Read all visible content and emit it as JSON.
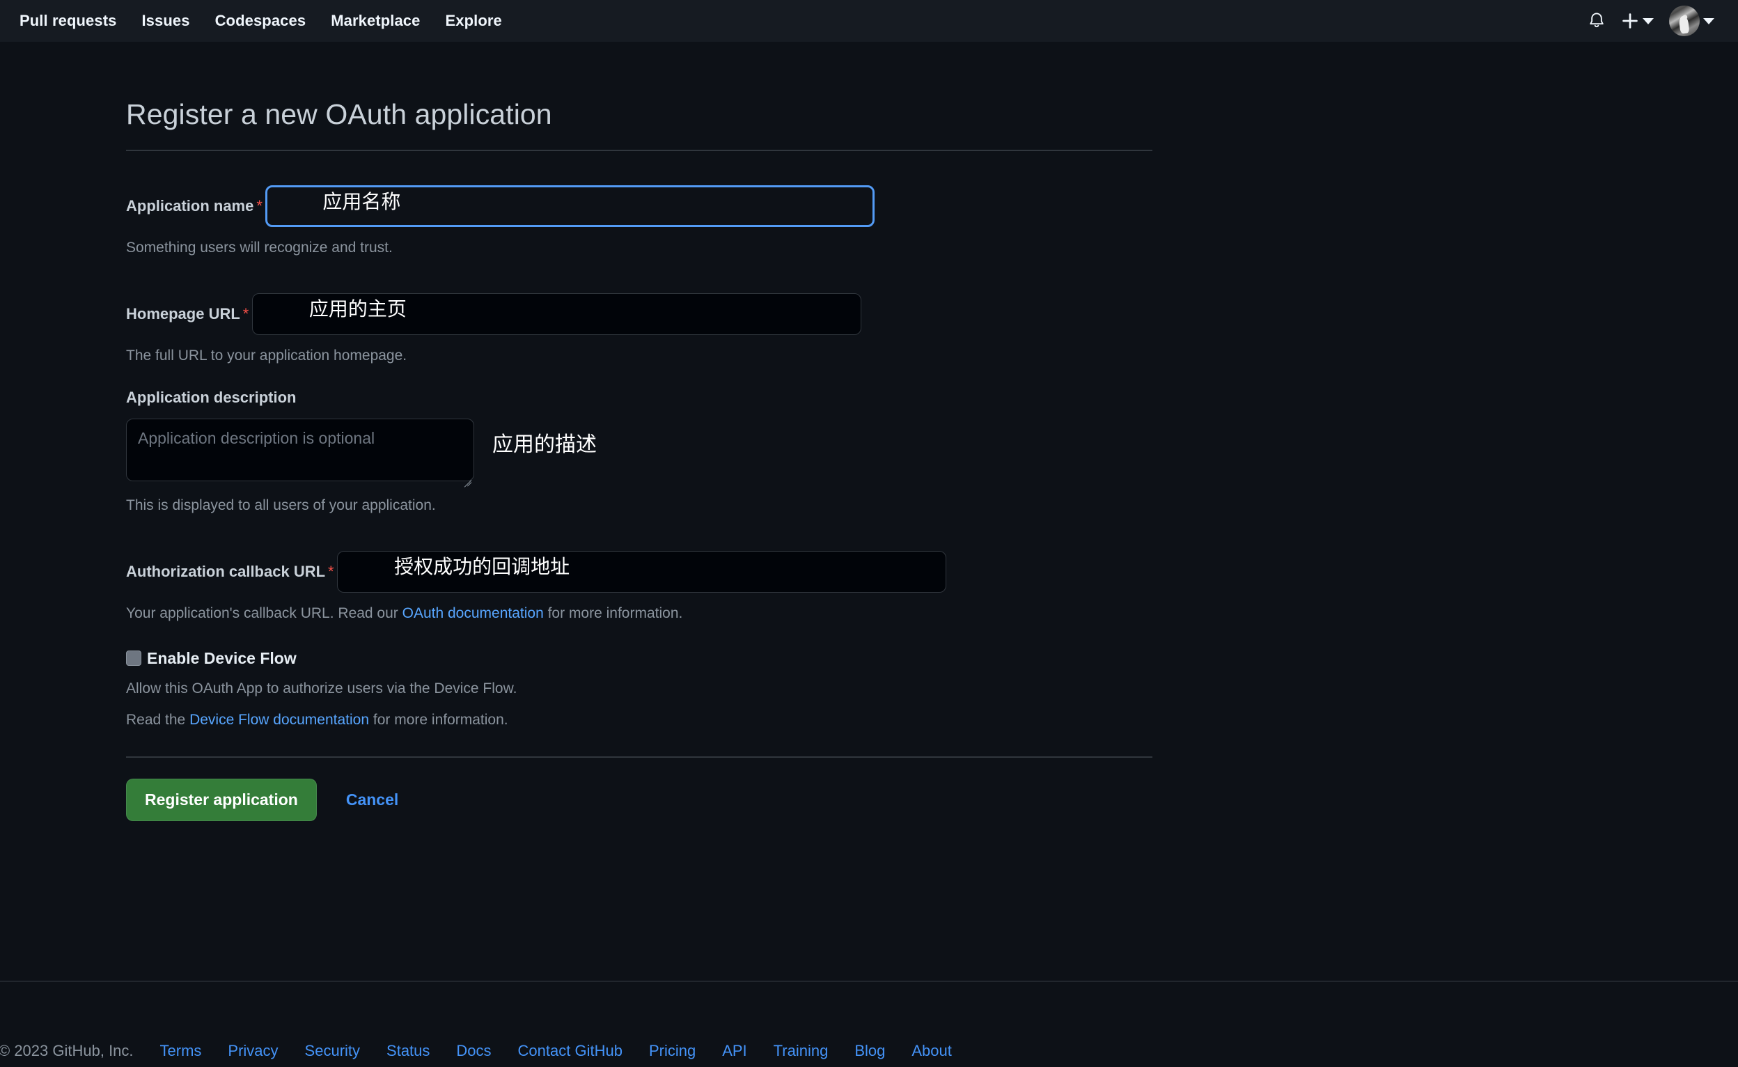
{
  "header": {
    "nav": [
      {
        "label": "Pull requests",
        "name": "nav-pull-requests"
      },
      {
        "label": "Issues",
        "name": "nav-issues"
      },
      {
        "label": "Codespaces",
        "name": "nav-codespaces"
      },
      {
        "label": "Marketplace",
        "name": "nav-marketplace"
      },
      {
        "label": "Explore",
        "name": "nav-explore"
      }
    ],
    "icons": {
      "notifications": "bell-icon",
      "create_new": "plus-icon",
      "create_new_chevron": "chevron-down-icon",
      "avatar": "avatar",
      "avatar_chevron": "chevron-down-icon"
    },
    "background": "#161b22"
  },
  "page": {
    "title": "Register a new OAuth application",
    "background": "#0d1117"
  },
  "form": {
    "app_name": {
      "label": "Application name",
      "required_marker": "*",
      "value": "",
      "placeholder": "",
      "annotation": "应用名称",
      "hint": "Something users will recognize and trust.",
      "focused": true
    },
    "homepage_url": {
      "label": "Homepage URL",
      "required_marker": "*",
      "value": "",
      "placeholder": "",
      "annotation": "应用的主页",
      "hint": "The full URL to your application homepage.",
      "focused": false
    },
    "description": {
      "label": "Application description",
      "value": "",
      "placeholder": "Application description is optional",
      "annotation": "应用的描述",
      "hint": "This is displayed to all users of your application."
    },
    "callback_url": {
      "label": "Authorization callback URL",
      "required_marker": "*",
      "value": "",
      "placeholder": "",
      "annotation": "授权成功的回调地址",
      "hint_before": "Your application's callback URL. Read our ",
      "hint_link": "OAuth documentation",
      "hint_after": " for more information.",
      "focused": false
    },
    "device_flow": {
      "label": "Enable Device Flow",
      "checked": false,
      "hint_line1": "Allow this OAuth App to authorize users via the Device Flow.",
      "hint_line2_before": "Read the ",
      "hint_line2_link": "Device Flow documentation",
      "hint_line2_after": " for more information."
    },
    "actions": {
      "submit_label": "Register application",
      "cancel_label": "Cancel",
      "submit_color": "#347d39",
      "cancel_color": "#4493f8"
    }
  },
  "footer": {
    "copyright": "© 2023 GitHub, Inc.",
    "links": [
      {
        "label": "Terms",
        "name": "footer-link-terms"
      },
      {
        "label": "Privacy",
        "name": "footer-link-privacy"
      },
      {
        "label": "Security",
        "name": "footer-link-security"
      },
      {
        "label": "Status",
        "name": "footer-link-status"
      },
      {
        "label": "Docs",
        "name": "footer-link-docs"
      },
      {
        "label": "Contact GitHub",
        "name": "footer-link-contact-github"
      },
      {
        "label": "Pricing",
        "name": "footer-link-pricing"
      },
      {
        "label": "API",
        "name": "footer-link-api"
      },
      {
        "label": "Training",
        "name": "footer-link-training"
      },
      {
        "label": "Blog",
        "name": "footer-link-blog"
      },
      {
        "label": "About",
        "name": "footer-link-about"
      }
    ]
  },
  "colors": {
    "accent_link": "#58a6ff",
    "required": "#f85149",
    "border": "#30363d",
    "focus_border": "#539bf5",
    "muted_text": "#8b949e"
  }
}
